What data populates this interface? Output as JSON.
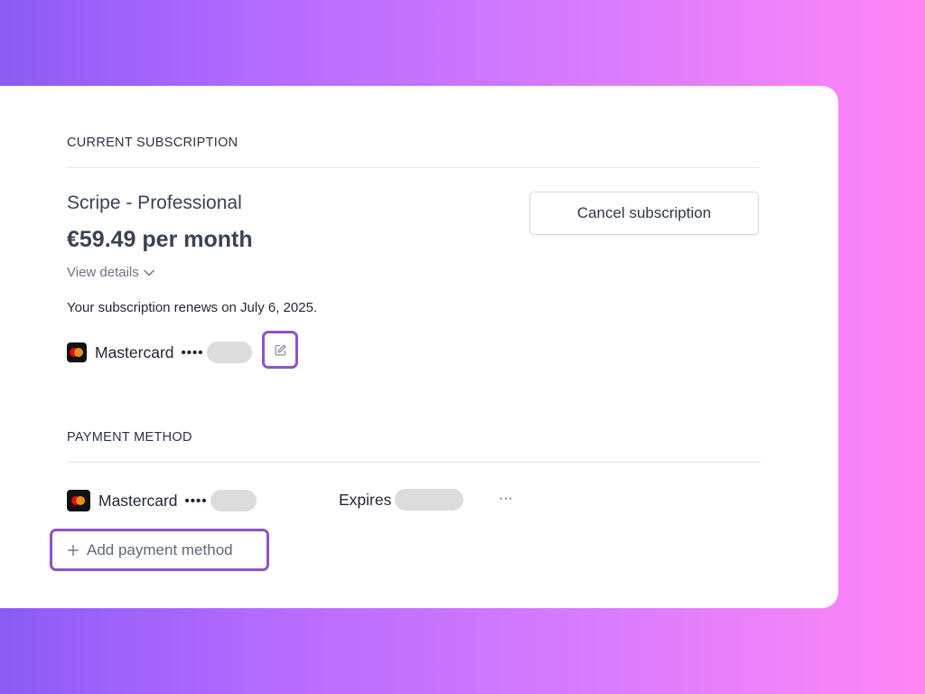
{
  "current_subscription": {
    "heading": "CURRENT SUBSCRIPTION",
    "plan_name": "Scripe - Professional",
    "price": "€59.49 per month",
    "view_details_label": "View details",
    "renewal_text": "Your subscription renews on July 6, 2025.",
    "cancel_label": "Cancel subscription",
    "card": {
      "brand": "Mastercard",
      "masked": "••••"
    }
  },
  "payment_method": {
    "heading": "PAYMENT METHOD",
    "card": {
      "brand": "Mastercard",
      "masked": "••••",
      "expires_label": "Expires",
      "more_label": "···"
    },
    "add_label": "Add payment method"
  },
  "colors": {
    "highlight_border": "#8e52c9",
    "redaction": "#dcdcdc",
    "mastercard_red": "#eb001b",
    "mastercard_orange": "#f79e1b"
  }
}
